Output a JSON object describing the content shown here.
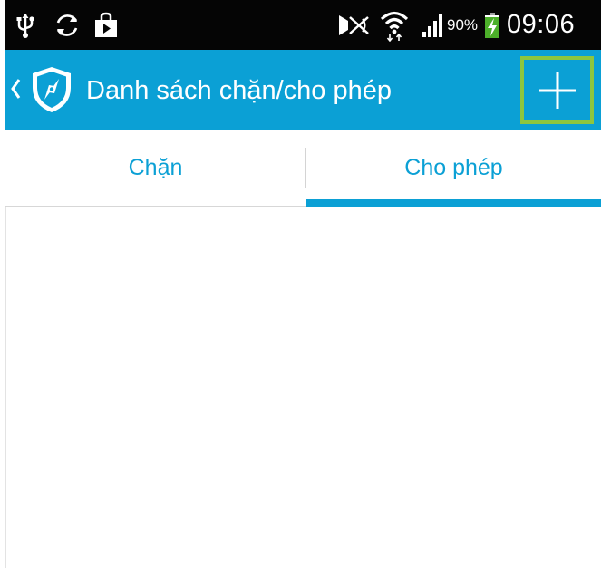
{
  "status_bar": {
    "battery_percent": "90%",
    "time": "09:06",
    "icons": [
      "usb-icon",
      "sync-icon",
      "play-store-icon",
      "mute-icon",
      "wifi-icon",
      "signal-icon",
      "charging-battery-icon"
    ]
  },
  "action_bar": {
    "title": "Danh sách chặn/cho phép",
    "back_icon": "chevron-left-icon",
    "logo_icon": "shield-compass-icon",
    "add_icon": "plus-icon"
  },
  "tabs": [
    {
      "label": "Chặn",
      "selected": false
    },
    {
      "label": "Cho phép",
      "selected": true
    }
  ],
  "colors": {
    "accent": "#0ba0d5",
    "status_bar_bg": "#050505",
    "highlight_border": "#8dc63f",
    "battery_bolt": "#4caf2a"
  }
}
